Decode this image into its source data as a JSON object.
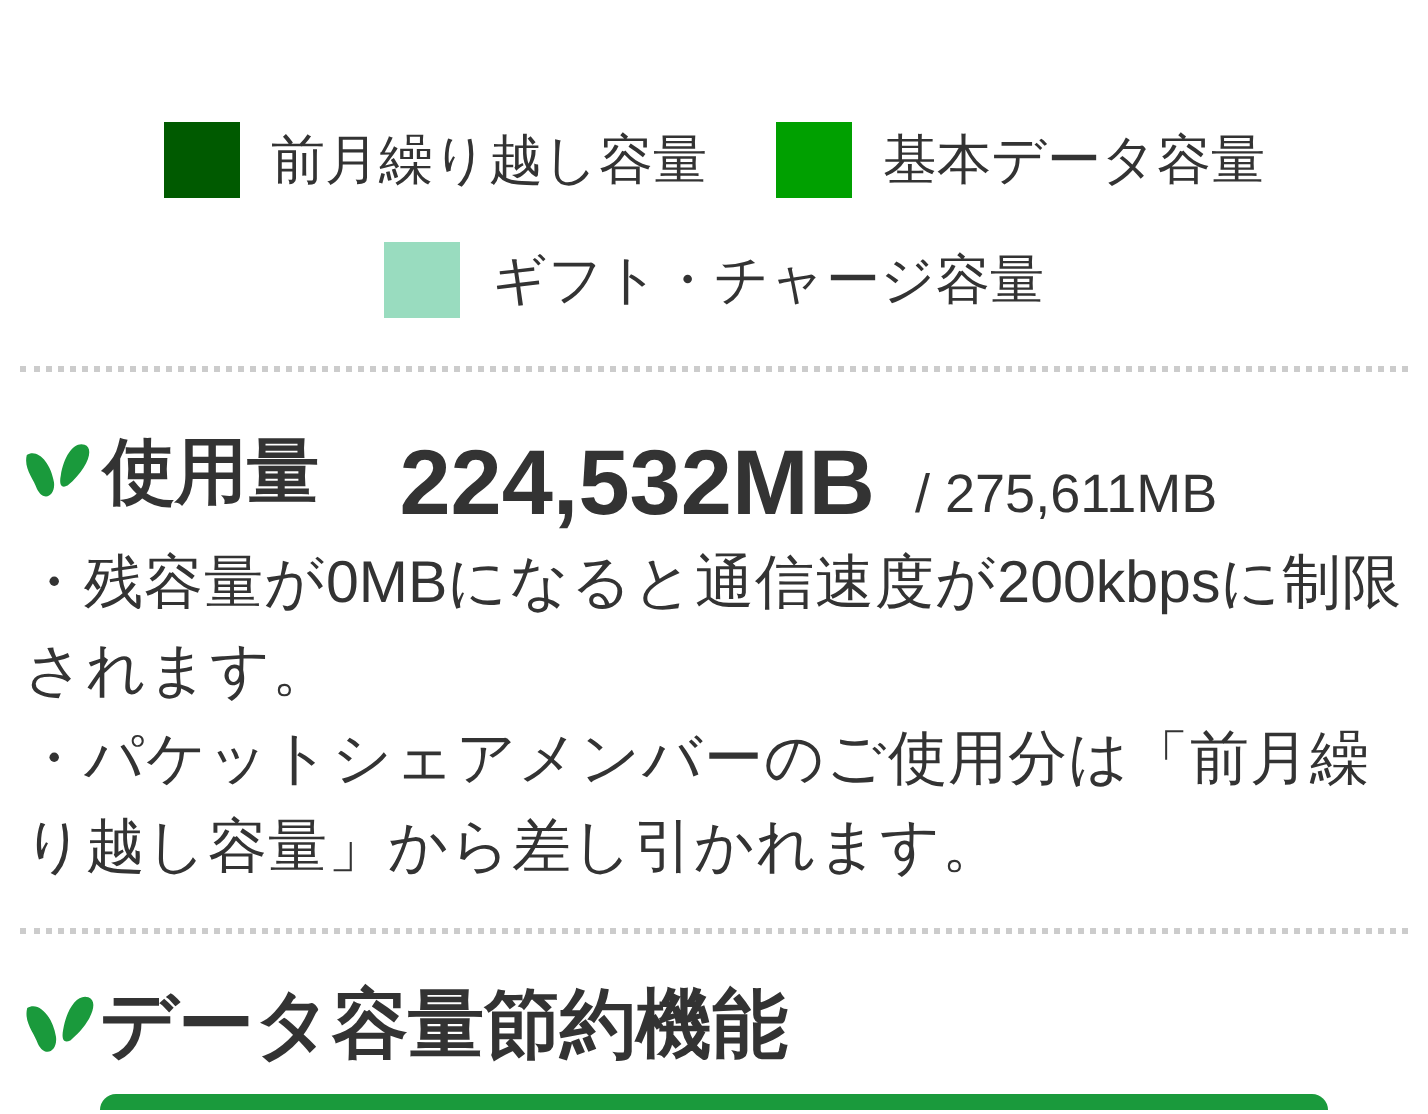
{
  "legend": [
    {
      "label": "前月繰り越し容量",
      "color": "#005a00"
    },
    {
      "label": "基本データ容量",
      "color": "#00a000"
    },
    {
      "label": "ギフト・チャージ容量",
      "color": "#99dcbf"
    }
  ],
  "usage": {
    "title": "使用量",
    "used": "224,532MB",
    "total": "/ 275,611MB"
  },
  "notes": [
    "・残容量が0MBになると通信速度が200kbpsに制限されます。",
    "・パケットシェアメンバーのご使用分は「前月繰り越し容量」から差し引かれます。"
  ],
  "section": {
    "title": "データ容量節約機能"
  }
}
